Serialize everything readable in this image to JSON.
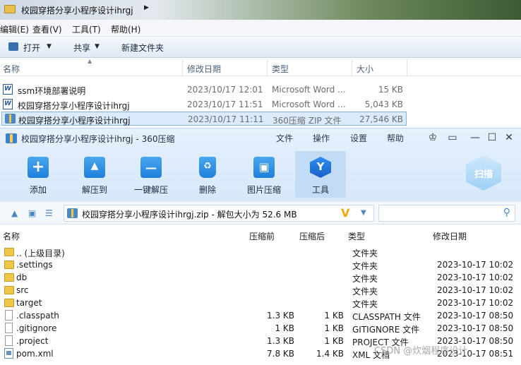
{
  "explorer": {
    "path": "校园穿搭分享小程序设计ihrgj",
    "menu": [
      "编辑(E)",
      "查看(V)",
      "工具(T)",
      "帮助(H)"
    ],
    "toolbar": {
      "open": "打开",
      "share": "共享",
      "new_folder": "新建文件夹"
    },
    "columns": {
      "name": "名称",
      "date": "修改日期",
      "type": "类型",
      "size": "大小"
    },
    "files": [
      {
        "name": "ssm环境部署说明",
        "date": "2023/10/17 12:01",
        "type": "Microsoft Word ...",
        "size": "15 KB",
        "icon": "word-doc-icon"
      },
      {
        "name": "校园穿搭分享小程序设计ihrgj",
        "date": "2023/10/17 11:51",
        "type": "Microsoft Word ...",
        "size": "5,043 KB",
        "icon": "word-doc-icon"
      },
      {
        "name": "校园穿搭分享小程序设计ihrgj",
        "date": "2023/10/17 11:11",
        "type": "360压缩 ZIP 文件",
        "size": "27,546 KB",
        "icon": "zip-file-icon"
      }
    ]
  },
  "zip": {
    "title": "校园穿搭分享小程序设计ihrgj - 360压缩",
    "menu": {
      "file": "文件",
      "ops": "操作",
      "settings": "设置",
      "help": "帮助"
    },
    "tools": {
      "add": "添加",
      "extract_to": "解压到",
      "one_click": "一键解压",
      "delete": "删除",
      "img_compress": "图片压缩",
      "tools": "工具"
    },
    "scan_label": "扫描",
    "address": "校园穿搭分享小程序设计ihrgj.zip - 解包大小为 52.6 MB",
    "columns": {
      "name": "名称",
      "compressed": "压缩前",
      "packed": "压缩后",
      "type": "类型",
      "modified": "修改日期"
    },
    "entries": [
      {
        "name": ".. (上级目录)",
        "before": "",
        "after": "",
        "type": "文件夹",
        "date": "",
        "icon": "folder-icon"
      },
      {
        "name": ".settings",
        "before": "",
        "after": "",
        "type": "文件夹",
        "date": "2023-10-17 10:02",
        "icon": "folder-icon"
      },
      {
        "name": "db",
        "before": "",
        "after": "",
        "type": "文件夹",
        "date": "2023-10-17 10:02",
        "icon": "folder-icon"
      },
      {
        "name": "src",
        "before": "",
        "after": "",
        "type": "文件夹",
        "date": "2023-10-17 10:02",
        "icon": "folder-icon"
      },
      {
        "name": "target",
        "before": "",
        "after": "",
        "type": "文件夹",
        "date": "2023-10-17 10:02",
        "icon": "folder-icon"
      },
      {
        "name": ".classpath",
        "before": "1.3 KB",
        "after": "1 KB",
        "type": "CLASSPATH 文件",
        "date": "2023-10-17 08:50",
        "icon": "file-icon"
      },
      {
        "name": ".gitignore",
        "before": "1 KB",
        "after": "1 KB",
        "type": "GITIGNORE 文件",
        "date": "2023-10-17 08:50",
        "icon": "file-icon"
      },
      {
        "name": ".project",
        "before": "1.3 KB",
        "after": "1 KB",
        "type": "PROJECT 文件",
        "date": "2023-10-17 08:50",
        "icon": "file-icon"
      },
      {
        "name": "pom.xml",
        "before": "7.8 KB",
        "after": "1.4 KB",
        "type": "XML 文档",
        "date": "2023-10-17 08:51",
        "icon": "xml-file-icon"
      }
    ]
  },
  "watermark": "CSDN @炊烟程序设计"
}
